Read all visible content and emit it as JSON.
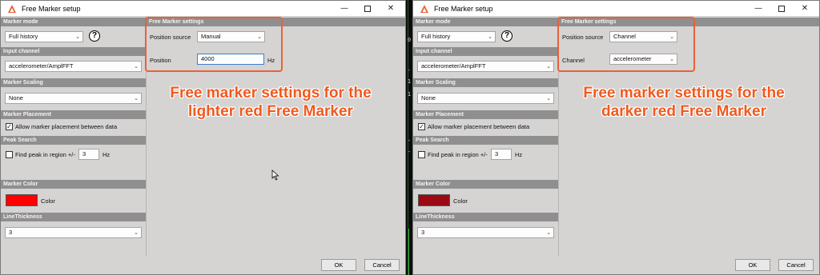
{
  "left": {
    "title": "Free Marker setup",
    "marker_mode": {
      "label": "Marker mode",
      "value": "Full history"
    },
    "input_channel": {
      "label": "Input channel",
      "value": "accelerometer/AmplFFT"
    },
    "marker_scaling": {
      "label": "Marker Scaling",
      "value": "None"
    },
    "marker_placement": {
      "label": "Marker Placement",
      "checkbox_label": "Allow marker placement between data",
      "checked": true
    },
    "peak_search": {
      "label": "Peak Search",
      "checkbox_label": "Find peak in region +/-",
      "value": "3",
      "unit": "Hz"
    },
    "marker_color": {
      "label": "Marker Color",
      "color_label": "Color",
      "color": "#ff0000"
    },
    "line_thickness": {
      "label": "LineThickness",
      "value": "3"
    },
    "free_marker_settings": {
      "header": "Free Marker settings",
      "position_source_label": "Position source",
      "position_source_value": "Manual",
      "position_label": "Position",
      "position_value": "4000",
      "position_unit": "Hz"
    },
    "caption_line1": "Free marker settings for the",
    "caption_line2": "lighter red Free Marker",
    "ok": "OK",
    "cancel": "Cancel"
  },
  "right": {
    "title": "Free Marker setup",
    "marker_mode": {
      "label": "Marker mode",
      "value": "Full history"
    },
    "input_channel": {
      "label": "Input channel",
      "value": "accelerometer/AmplFFT"
    },
    "marker_scaling": {
      "label": "Marker Scaling",
      "value": "None"
    },
    "marker_placement": {
      "label": "Marker Placement",
      "checkbox_label": "Allow marker placement between data",
      "checked": true
    },
    "peak_search": {
      "label": "Peak Search",
      "checkbox_label": "Find peak in region +/-",
      "value": "3",
      "unit": "Hz"
    },
    "marker_color": {
      "label": "Marker Color",
      "color_label": "Color",
      "color": "#9b0a14"
    },
    "line_thickness": {
      "label": "LineThickness",
      "value": "3"
    },
    "free_marker_settings": {
      "header": "Free Marker settings",
      "position_source_label": "Position source",
      "position_source_value": "Channel",
      "channel_label": "Channel",
      "channel_value": "accelerometer"
    },
    "caption_line1": "Free marker settings for the",
    "caption_line2": "darker red Free Marker",
    "ok": "OK",
    "cancel": "Cancel"
  },
  "background_strip": {
    "marks": [
      "0",
      "-",
      "1",
      "1",
      "-",
      "-"
    ]
  },
  "colors": {
    "highlight": "#e8613a",
    "caption": "#ef5a1e",
    "section_header": "#8f8f8f",
    "dialog_bg": "#d6d3d3"
  },
  "icons": {
    "app": "app-logo-icon",
    "help": "help-icon",
    "dropdown": "chevron-down-icon",
    "check": "checkmark-icon"
  }
}
